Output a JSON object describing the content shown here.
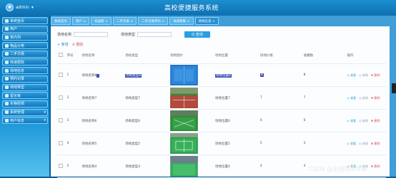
{
  "header": {
    "title": "高校便捷服务系统",
    "username": "admin"
  },
  "sidebar": {
    "items": [
      {
        "label": "系统首页"
      },
      {
        "label": "用户"
      },
      {
        "label": "校内列"
      },
      {
        "label": "物品分类"
      },
      {
        "label": "二手交易"
      },
      {
        "label": "快递帮取"
      },
      {
        "label": "场地信息"
      },
      {
        "label": "预约记录"
      },
      {
        "label": "场地类型"
      },
      {
        "label": "留言板"
      },
      {
        "label": "失物招领"
      },
      {
        "label": "系统管理",
        "caret": "▾"
      },
      {
        "label": "用户信息",
        "caret": "▾"
      }
    ]
  },
  "tabs": [
    {
      "label": "系统首页"
    },
    {
      "label": "用户 ×"
    },
    {
      "label": "校园新 ×"
    },
    {
      "label": "二手交易 ×"
    },
    {
      "label": "二手交易评论 ×"
    },
    {
      "label": "快递帮取 ×"
    },
    {
      "label": "场地信息 ×"
    }
  ],
  "filter": {
    "name_label": "场地名称",
    "name_placeholder": "",
    "type_label": "场地类型",
    "type_placeholder": "",
    "search_label": "Q 查询"
  },
  "actions": {
    "add_label": "+ 新增",
    "delete_label": "⊖ 删除"
  },
  "table": {
    "columns": [
      "序号",
      "场地名称",
      "场地类型",
      "场地图片",
      "场地位置",
      "场地价格",
      "收藏数",
      "操作"
    ],
    "rows": [
      {
        "index": "1",
        "name": "场地名称8",
        "type": "场地类型8",
        "location": "场地位置8",
        "price": "8",
        "fav": "8"
      },
      {
        "index": "2",
        "name": "场地名称7",
        "type": "场地类型7",
        "location": "场地位置7",
        "price": "7",
        "fav": "7"
      },
      {
        "index": "3",
        "name": "场地名称6",
        "type": "场地类型6",
        "location": "场地位置6",
        "price": "6",
        "fav": "6"
      },
      {
        "index": "4",
        "name": "场地名称5",
        "type": "场地类型5",
        "location": "场地位置5",
        "price": "5",
        "fav": "5"
      },
      {
        "index": "5",
        "name": "场地名称4",
        "type": "场地类型4",
        "location": "场地位置4",
        "price": "4",
        "fav": "4"
      }
    ],
    "op_view": "◎ 查看",
    "op_edit": "◎ 修改",
    "op_delete": "✖ 删除"
  },
  "watermark": "CSDN @全栈程序华哥",
  "colors": {
    "topbar": "#1b8fd0",
    "sidebar": "#0d6fae",
    "accent": "#2a9fe0",
    "highlight": "#3f51b5"
  }
}
